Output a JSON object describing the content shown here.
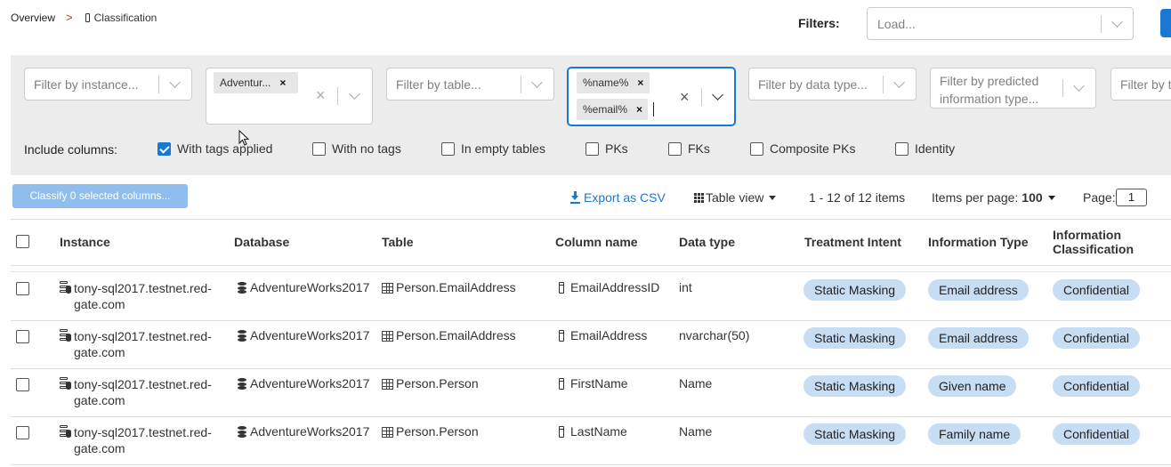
{
  "breadcrumb": {
    "overview": "Overview",
    "separator": ">",
    "current": "Classification"
  },
  "filters_label": "Filters:",
  "load_placeholder": "Load...",
  "filters": {
    "instance_placeholder": "Filter by instance...",
    "database_tag": "Adventur...",
    "table_placeholder": "Filter by table...",
    "column_tags": [
      "%name%",
      "%email%"
    ],
    "datatype_placeholder": "Filter by data type...",
    "predicted_placeholder_line1": "Filter by predicted",
    "predicted_placeholder_line2": "information type...",
    "cut_placeholder": "Filter by t"
  },
  "include_columns": {
    "label": "Include columns:",
    "options": [
      {
        "label": "With tags applied",
        "checked": true
      },
      {
        "label": "With no tags",
        "checked": false
      },
      {
        "label": "In empty tables",
        "checked": false
      },
      {
        "label": "PKs",
        "checked": false
      },
      {
        "label": "FKs",
        "checked": false
      },
      {
        "label": "Composite PKs",
        "checked": false
      },
      {
        "label": "Identity",
        "checked": false
      }
    ]
  },
  "toolbar": {
    "classify_label": "Classify 0 selected columns...",
    "export_label": "Export as CSV",
    "table_view_label": "Table view",
    "count_text": "1 - 12 of 12 items",
    "items_per_page_label": "Items per page:",
    "items_per_page_value": "100",
    "page_label": "Page:",
    "page_value": "1"
  },
  "table": {
    "headers": [
      "Instance",
      "Database",
      "Table",
      "Column name",
      "Data type",
      "Treatment Intent",
      "Information Type",
      "Information Classification"
    ],
    "rows": [
      {
        "instance": "tony-sql2017.testnet.red-gate.com",
        "database": "AdventureWorks2017",
        "table": "Person.EmailAddress",
        "column": "EmailAddressID",
        "datatype": "int",
        "treatment": "Static Masking",
        "info_type": "Email address",
        "classification": "Confidential"
      },
      {
        "instance": "tony-sql2017.testnet.red-gate.com",
        "database": "AdventureWorks2017",
        "table": "Person.EmailAddress",
        "column": "EmailAddress",
        "datatype": "nvarchar(50)",
        "treatment": "Static Masking",
        "info_type": "Email address",
        "classification": "Confidential"
      },
      {
        "instance": "tony-sql2017.testnet.red-gate.com",
        "database": "AdventureWorks2017",
        "table": "Person.Person",
        "column": "FirstName",
        "datatype": "Name",
        "treatment": "Static Masking",
        "info_type": "Given name",
        "classification": "Confidential"
      },
      {
        "instance": "tony-sql2017.testnet.red-gate.com",
        "database": "AdventureWorks2017",
        "table": "Person.Person",
        "column": "LastName",
        "datatype": "Name",
        "treatment": "Static Masking",
        "info_type": "Family name",
        "classification": "Confidential"
      }
    ]
  },
  "colors": {
    "accent": "#1a78d2",
    "pill": "#c6ddf3",
    "panel": "#ececec"
  }
}
